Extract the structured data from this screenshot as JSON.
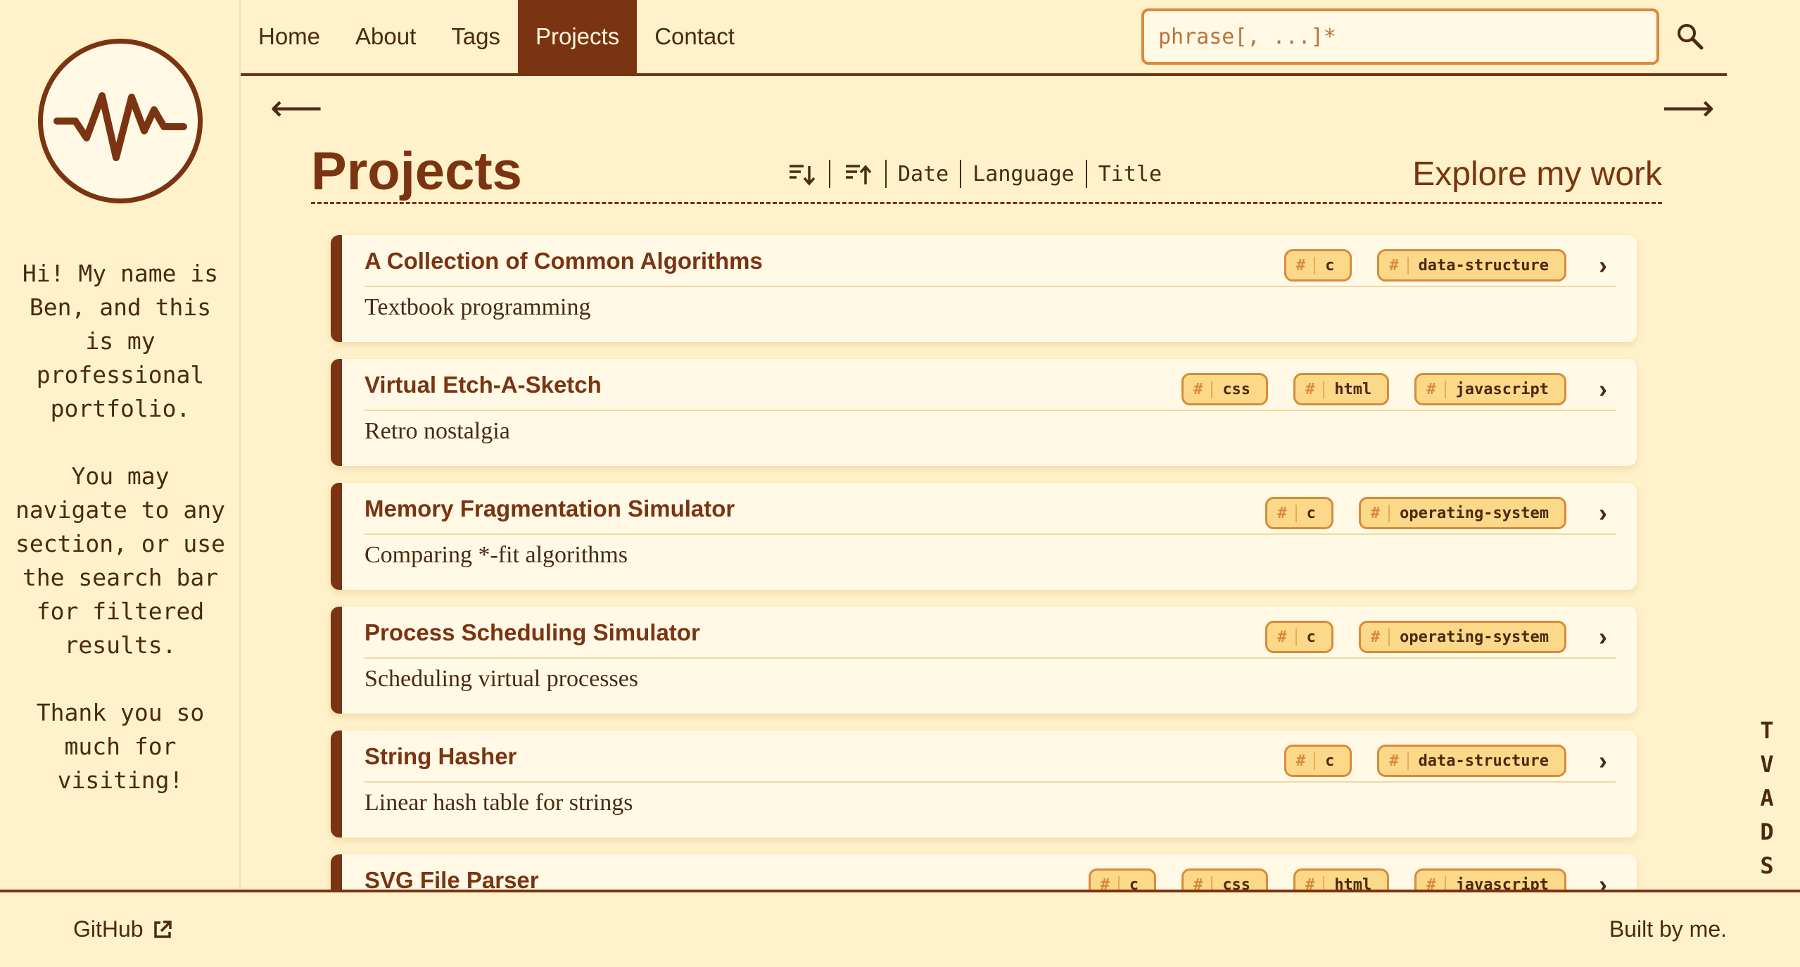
{
  "nav": {
    "links": [
      "Home",
      "About",
      "Tags",
      "Projects",
      "Contact"
    ],
    "active": "Projects",
    "search_placeholder": "phrase[, ...]*"
  },
  "sidebar": {
    "intro": [
      "Hi! My name is Ben, and this is my professional portfolio.",
      "You may navigate to any section, or use the search bar for filtered results.",
      "Thank you so much for visiting!"
    ]
  },
  "page": {
    "title": "Projects",
    "subtitle": "Explore my work",
    "sort_options": [
      "Date",
      "Language",
      "Title"
    ]
  },
  "projects": [
    {
      "title": "A Collection of Common Algorithms",
      "desc": "Textbook programming",
      "tags": [
        "c",
        "data-structure"
      ]
    },
    {
      "title": "Virtual Etch-A-Sketch",
      "desc": "Retro nostalgia",
      "tags": [
        "css",
        "html",
        "javascript"
      ]
    },
    {
      "title": "Memory Fragmentation Simulator",
      "desc": "Comparing *-fit algorithms",
      "tags": [
        "c",
        "operating-system"
      ]
    },
    {
      "title": "Process Scheduling Simulator",
      "desc": "Scheduling virtual processes",
      "tags": [
        "c",
        "operating-system"
      ]
    },
    {
      "title": "String Hasher",
      "desc": "Linear hash table for strings",
      "tags": [
        "c",
        "data-structure"
      ]
    },
    {
      "title": "SVG File Parser",
      "desc": "",
      "tags": [
        "c",
        "css",
        "html",
        "javascript"
      ]
    }
  ],
  "tag_symbol": "#",
  "side_letters": [
    "T",
    "V",
    "A",
    "D",
    "S"
  ],
  "footer": {
    "github": "GitHub",
    "built": "Built by me."
  },
  "colors": {
    "background": "#fff1c9",
    "accent": "#7a3412",
    "tag_fill": "#fcd889",
    "tag_border": "#d98a3a"
  }
}
